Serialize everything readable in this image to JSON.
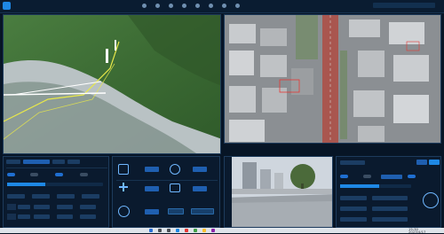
{
  "app": {
    "brand_color": "#1e88e5",
    "icon": "app-logo-icon"
  },
  "titlebar": {
    "nav_icons": [
      "nav-icon-1",
      "nav-icon-2",
      "nav-icon-3",
      "nav-icon-4",
      "nav-icon-5",
      "nav-icon-6",
      "nav-icon-7",
      "nav-icon-8"
    ]
  },
  "map3d": {
    "route_color": "#e8e84a",
    "icon": "terrain-3d-view"
  },
  "aerial": {
    "road_color": "#b7514d",
    "icon": "aerial-camera-view"
  },
  "controls_left": {
    "rows": 3
  },
  "controls_mid": {
    "icons": [
      "power-icon",
      "dpad-icon",
      "plus-icon",
      "timer-icon"
    ]
  },
  "controls_right": {
    "toggles": [
      true,
      false,
      true,
      false
    ],
    "joystick_icon": "joystick-icon"
  },
  "camera": {
    "icon": "camera-feed",
    "sky_color": "#cfd6de"
  },
  "taskbar": {
    "icons": [
      "start-icon",
      "search-icon",
      "taskview-icon",
      "app-1-icon",
      "app-2-icon",
      "app-3-icon",
      "app-4-icon",
      "app-5-icon"
    ],
    "clock": "15:30",
    "date": "2023/4/17"
  }
}
